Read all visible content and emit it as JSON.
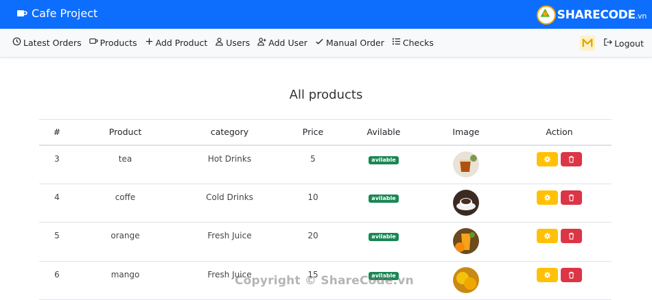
{
  "app": {
    "title": "Cafe Project",
    "brand_color": "#0d6efd",
    "logo_text": "SHARECODE",
    "logo_suffix": ".vn"
  },
  "nav": {
    "items": [
      {
        "label": "Latest Orders",
        "icon": "clock-icon"
      },
      {
        "label": "Products",
        "icon": "cup-icon"
      },
      {
        "label": "Add Product",
        "icon": "plus-icon"
      },
      {
        "label": "Users",
        "icon": "user-icon"
      },
      {
        "label": "Add User",
        "icon": "user-plus-icon"
      },
      {
        "label": "Manual Order",
        "icon": "check-icon"
      },
      {
        "label": "Checks",
        "icon": "list-icon"
      }
    ],
    "logout": "Logout"
  },
  "main": {
    "title": "All products",
    "columns": [
      "#",
      "Product",
      "category",
      "Price",
      "Avilable",
      "Image",
      "Action"
    ],
    "rows": [
      {
        "id": "3",
        "product": "tea",
        "category": "Hot Drinks",
        "price": "5",
        "status": "avilable",
        "image": "tea-photo"
      },
      {
        "id": "4",
        "product": "coffe",
        "category": "Cold Drinks",
        "price": "10",
        "status": "avilable",
        "image": "coffee-photo"
      },
      {
        "id": "5",
        "product": "orange",
        "category": "Fresh Juice",
        "price": "20",
        "status": "avilable",
        "image": "orange-juice-photo"
      },
      {
        "id": "6",
        "product": "mango",
        "category": "Fresh Juice",
        "price": "15",
        "status": "avilable",
        "image": "mango-photo"
      }
    ]
  },
  "colors": {
    "edit": "#ffc107",
    "delete": "#dc3545",
    "available": "#198754"
  },
  "watermark": "Copyright © ShareCode.vn"
}
